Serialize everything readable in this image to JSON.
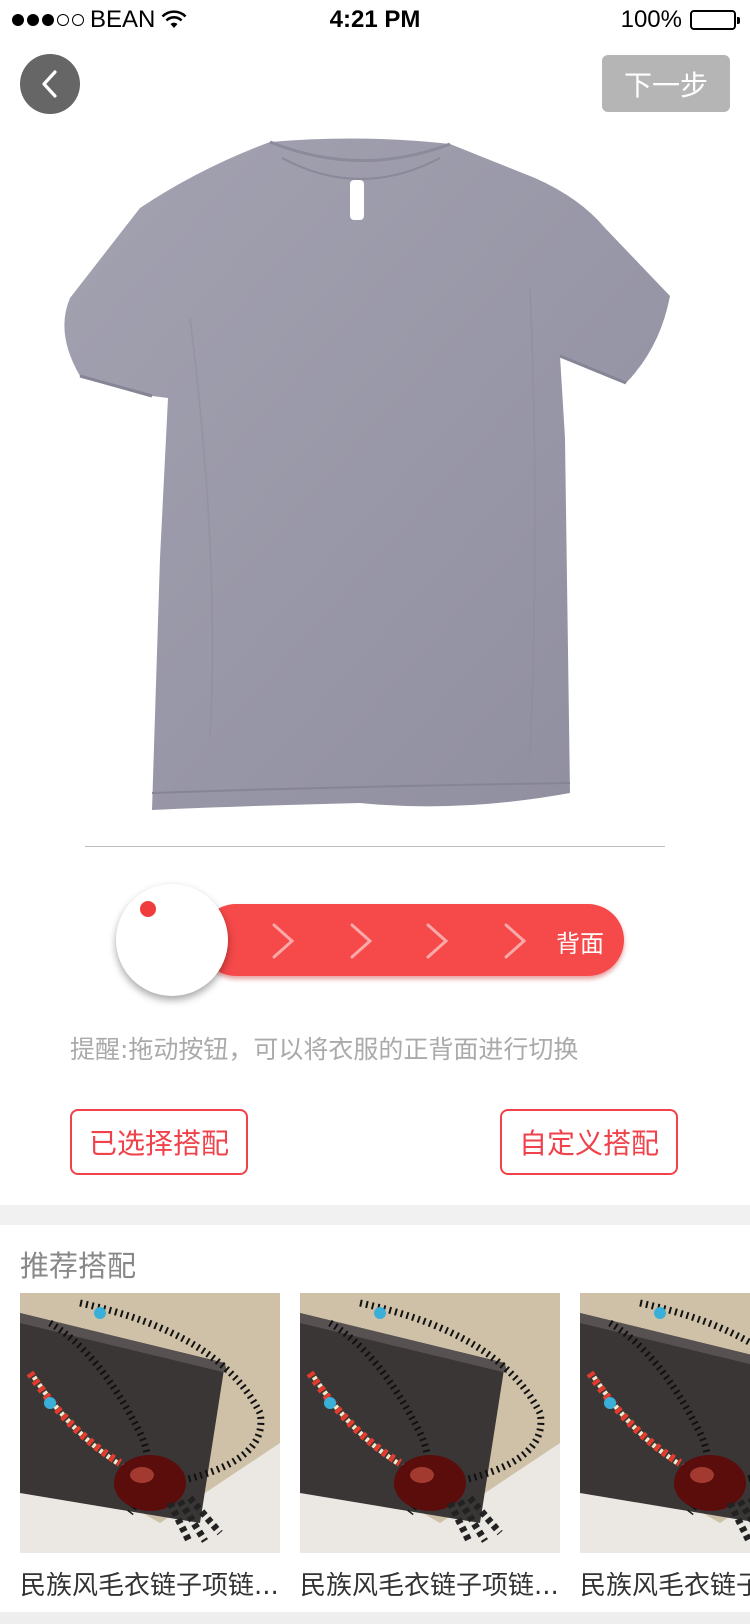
{
  "status_bar": {
    "carrier": "BEAN",
    "time": "4:21 PM",
    "battery": "100%"
  },
  "nav": {
    "back_icon": "chevron-left-icon",
    "next_label": "下一步"
  },
  "garment": {
    "type": "t-shirt",
    "color": "#9a99a8"
  },
  "switcher": {
    "label": "背面"
  },
  "hint": "提醒:拖动按钮，可以将衣服的正背面进行切换",
  "actions": {
    "selected_label": "已选择搭配",
    "custom_label": "自定义搭配"
  },
  "recommend": {
    "title": "推荐搭配",
    "items": [
      {
        "label": "民族风毛衣链子项链..."
      },
      {
        "label": "民族风毛衣链子项链..."
      },
      {
        "label": "民族风毛衣链子项链..."
      }
    ]
  },
  "colors": {
    "accent": "#f5494a",
    "next_disabled": "#b5b5b5",
    "back_button": "#666666"
  }
}
